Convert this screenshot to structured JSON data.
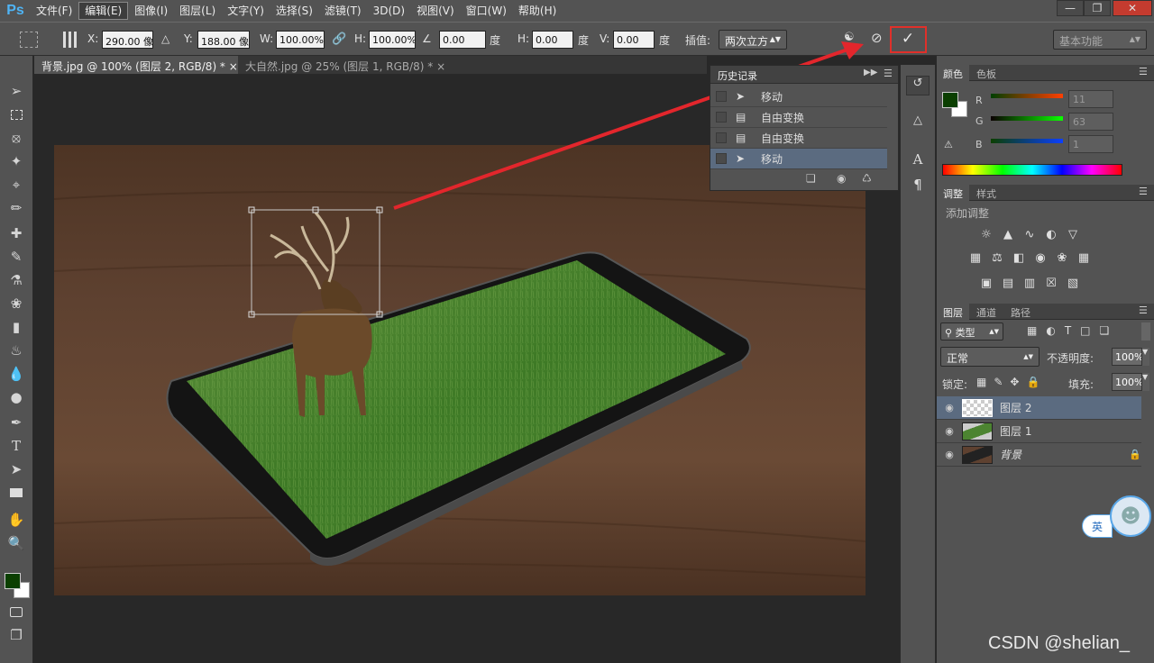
{
  "app": {
    "logo": "Ps"
  },
  "menu": [
    "文件(F)",
    "编辑(E)",
    "图像(I)",
    "图层(L)",
    "文字(Y)",
    "选择(S)",
    "滤镜(T)",
    "3D(D)",
    "视图(V)",
    "窗口(W)",
    "帮助(H)"
  ],
  "options": {
    "x_label": "X:",
    "x_value": "290.00 像",
    "y_label": "Y:",
    "y_value": "188.00 像",
    "w_label": "W:",
    "w_value": "100.00%",
    "h_label": "H:",
    "h_value": "100.00%",
    "angle_value": "0.00",
    "angle_unit": "度",
    "hskew_label": "H:",
    "hskew_value": "0.00",
    "hskew_unit": "度",
    "vskew_label": "V:",
    "vskew_value": "0.00",
    "vskew_unit": "度",
    "interp_label": "插值:",
    "interp_value": "两次立方",
    "workspace": "基本功能"
  },
  "tabs": [
    {
      "label": "背景.jpg @ 100% (图层 2, RGB/8) *"
    },
    {
      "label": "大自然.jpg @ 25% (图层 1, RGB/8) *"
    }
  ],
  "history": {
    "title": "历史记录",
    "items": [
      {
        "label": "移动",
        "icon": "move-icon"
      },
      {
        "label": "自由变换",
        "icon": "document-icon"
      },
      {
        "label": "自由变换",
        "icon": "document-icon"
      },
      {
        "label": "移动",
        "icon": "move-icon"
      }
    ]
  },
  "color_panel": {
    "tabs": [
      "颜色",
      "色板"
    ],
    "r_label": "R",
    "r_value": "11",
    "g_label": "G",
    "g_value": "63",
    "b_label": "B",
    "b_value": "1",
    "foreground": "#0b3f01",
    "background": "#ffffff"
  },
  "adjustments": {
    "tabs": [
      "调整",
      "样式"
    ],
    "heading": "添加调整"
  },
  "layers_panel": {
    "tabs": [
      "图层",
      "通道",
      "路径"
    ],
    "filter_label": "类型",
    "blend_mode": "正常",
    "opacity_label": "不透明度:",
    "opacity_value": "100%",
    "lock_label": "锁定:",
    "fill_label": "填充:",
    "fill_value": "100%",
    "layers": [
      {
        "name": "图层 2",
        "selected": true
      },
      {
        "name": "图层 1",
        "selected": false
      },
      {
        "name": "背景",
        "selected": false,
        "locked": true
      }
    ]
  },
  "ime_badge": "英",
  "watermark": "CSDN @shelian_"
}
